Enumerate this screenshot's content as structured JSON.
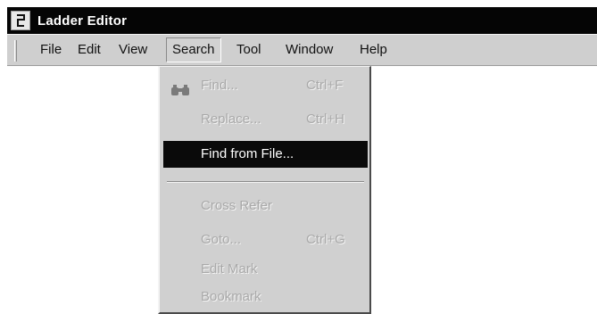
{
  "window": {
    "title": "Ladder Editor",
    "icon": "ladder-editor-app-icon"
  },
  "menu_bar": {
    "items": [
      {
        "label": "File",
        "mnemonic": "F"
      },
      {
        "label": "Edit",
        "mnemonic": "E"
      },
      {
        "label": "View",
        "mnemonic": "V"
      },
      {
        "label": "Search",
        "mnemonic": "S",
        "active": true
      },
      {
        "label": "Tool",
        "mnemonic": "T"
      },
      {
        "label": "Window",
        "mnemonic": "W"
      },
      {
        "label": "Help",
        "mnemonic": "H"
      }
    ]
  },
  "search_menu": {
    "items": [
      {
        "label": "Find...",
        "shortcut": "Ctrl+F",
        "enabled": false,
        "icon": "binoculars-icon"
      },
      {
        "label": "Replace...",
        "shortcut": "Ctrl+H",
        "enabled": false
      },
      {
        "label": "Find from File...",
        "shortcut": "",
        "enabled": true,
        "highlighted": true
      },
      {
        "label": "Cross Refer",
        "shortcut": "",
        "enabled": false
      },
      {
        "label": "Goto...",
        "shortcut": "Ctrl+G",
        "enabled": false
      },
      {
        "label": "Edit Mark",
        "shortcut": "",
        "enabled": false
      },
      {
        "label": "Bookmark",
        "shortcut": "",
        "enabled": false
      }
    ]
  },
  "colors": {
    "title_bar": "#050505",
    "menu_bg": "#cfcfcf",
    "highlight_bg": "#0a0a0a",
    "disabled_text": "#a9a9a9"
  }
}
